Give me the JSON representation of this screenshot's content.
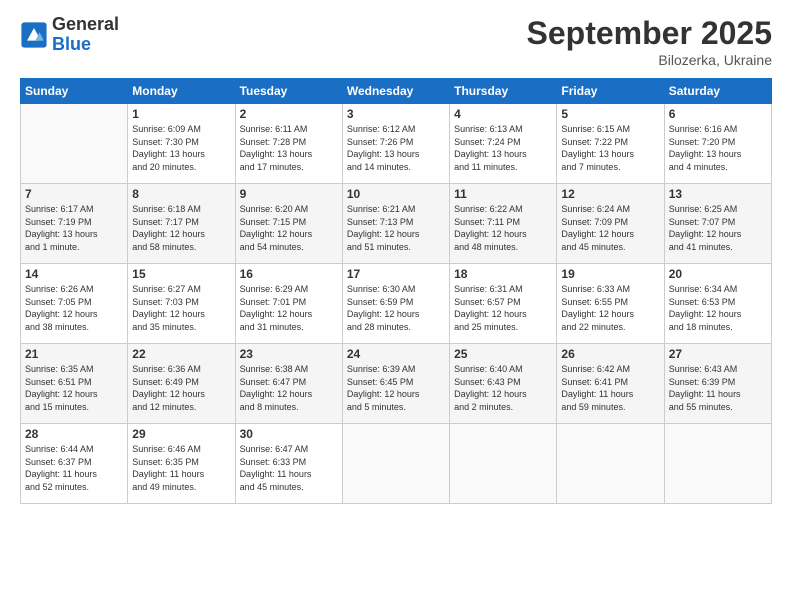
{
  "logo": {
    "general": "General",
    "blue": "Blue"
  },
  "header": {
    "month": "September 2025",
    "location": "Bilozerka, Ukraine"
  },
  "weekdays": [
    "Sunday",
    "Monday",
    "Tuesday",
    "Wednesday",
    "Thursday",
    "Friday",
    "Saturday"
  ],
  "weeks": [
    [
      {
        "day": "",
        "info": ""
      },
      {
        "day": "1",
        "info": "Sunrise: 6:09 AM\nSunset: 7:30 PM\nDaylight: 13 hours\nand 20 minutes."
      },
      {
        "day": "2",
        "info": "Sunrise: 6:11 AM\nSunset: 7:28 PM\nDaylight: 13 hours\nand 17 minutes."
      },
      {
        "day": "3",
        "info": "Sunrise: 6:12 AM\nSunset: 7:26 PM\nDaylight: 13 hours\nand 14 minutes."
      },
      {
        "day": "4",
        "info": "Sunrise: 6:13 AM\nSunset: 7:24 PM\nDaylight: 13 hours\nand 11 minutes."
      },
      {
        "day": "5",
        "info": "Sunrise: 6:15 AM\nSunset: 7:22 PM\nDaylight: 13 hours\nand 7 minutes."
      },
      {
        "day": "6",
        "info": "Sunrise: 6:16 AM\nSunset: 7:20 PM\nDaylight: 13 hours\nand 4 minutes."
      }
    ],
    [
      {
        "day": "7",
        "info": "Sunrise: 6:17 AM\nSunset: 7:19 PM\nDaylight: 13 hours\nand 1 minute."
      },
      {
        "day": "8",
        "info": "Sunrise: 6:18 AM\nSunset: 7:17 PM\nDaylight: 12 hours\nand 58 minutes."
      },
      {
        "day": "9",
        "info": "Sunrise: 6:20 AM\nSunset: 7:15 PM\nDaylight: 12 hours\nand 54 minutes."
      },
      {
        "day": "10",
        "info": "Sunrise: 6:21 AM\nSunset: 7:13 PM\nDaylight: 12 hours\nand 51 minutes."
      },
      {
        "day": "11",
        "info": "Sunrise: 6:22 AM\nSunset: 7:11 PM\nDaylight: 12 hours\nand 48 minutes."
      },
      {
        "day": "12",
        "info": "Sunrise: 6:24 AM\nSunset: 7:09 PM\nDaylight: 12 hours\nand 45 minutes."
      },
      {
        "day": "13",
        "info": "Sunrise: 6:25 AM\nSunset: 7:07 PM\nDaylight: 12 hours\nand 41 minutes."
      }
    ],
    [
      {
        "day": "14",
        "info": "Sunrise: 6:26 AM\nSunset: 7:05 PM\nDaylight: 12 hours\nand 38 minutes."
      },
      {
        "day": "15",
        "info": "Sunrise: 6:27 AM\nSunset: 7:03 PM\nDaylight: 12 hours\nand 35 minutes."
      },
      {
        "day": "16",
        "info": "Sunrise: 6:29 AM\nSunset: 7:01 PM\nDaylight: 12 hours\nand 31 minutes."
      },
      {
        "day": "17",
        "info": "Sunrise: 6:30 AM\nSunset: 6:59 PM\nDaylight: 12 hours\nand 28 minutes."
      },
      {
        "day": "18",
        "info": "Sunrise: 6:31 AM\nSunset: 6:57 PM\nDaylight: 12 hours\nand 25 minutes."
      },
      {
        "day": "19",
        "info": "Sunrise: 6:33 AM\nSunset: 6:55 PM\nDaylight: 12 hours\nand 22 minutes."
      },
      {
        "day": "20",
        "info": "Sunrise: 6:34 AM\nSunset: 6:53 PM\nDaylight: 12 hours\nand 18 minutes."
      }
    ],
    [
      {
        "day": "21",
        "info": "Sunrise: 6:35 AM\nSunset: 6:51 PM\nDaylight: 12 hours\nand 15 minutes."
      },
      {
        "day": "22",
        "info": "Sunrise: 6:36 AM\nSunset: 6:49 PM\nDaylight: 12 hours\nand 12 minutes."
      },
      {
        "day": "23",
        "info": "Sunrise: 6:38 AM\nSunset: 6:47 PM\nDaylight: 12 hours\nand 8 minutes."
      },
      {
        "day": "24",
        "info": "Sunrise: 6:39 AM\nSunset: 6:45 PM\nDaylight: 12 hours\nand 5 minutes."
      },
      {
        "day": "25",
        "info": "Sunrise: 6:40 AM\nSunset: 6:43 PM\nDaylight: 12 hours\nand 2 minutes."
      },
      {
        "day": "26",
        "info": "Sunrise: 6:42 AM\nSunset: 6:41 PM\nDaylight: 11 hours\nand 59 minutes."
      },
      {
        "day": "27",
        "info": "Sunrise: 6:43 AM\nSunset: 6:39 PM\nDaylight: 11 hours\nand 55 minutes."
      }
    ],
    [
      {
        "day": "28",
        "info": "Sunrise: 6:44 AM\nSunset: 6:37 PM\nDaylight: 11 hours\nand 52 minutes."
      },
      {
        "day": "29",
        "info": "Sunrise: 6:46 AM\nSunset: 6:35 PM\nDaylight: 11 hours\nand 49 minutes."
      },
      {
        "day": "30",
        "info": "Sunrise: 6:47 AM\nSunset: 6:33 PM\nDaylight: 11 hours\nand 45 minutes."
      },
      {
        "day": "",
        "info": ""
      },
      {
        "day": "",
        "info": ""
      },
      {
        "day": "",
        "info": ""
      },
      {
        "day": "",
        "info": ""
      }
    ]
  ]
}
